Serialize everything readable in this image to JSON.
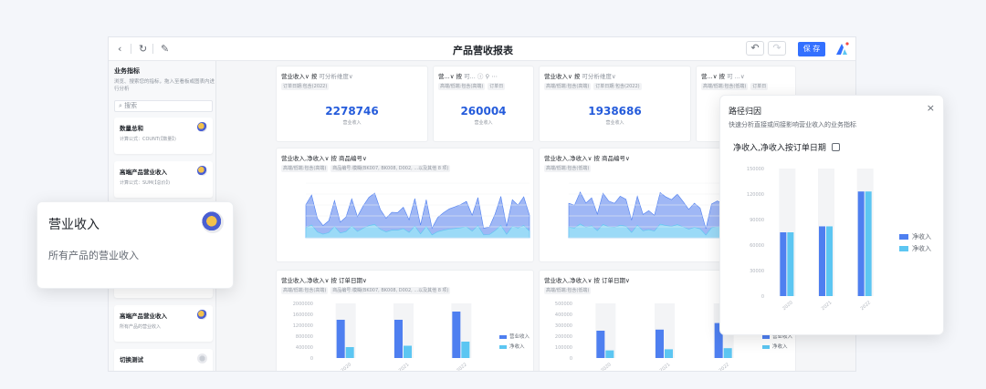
{
  "colors": {
    "accent": "#3370ff",
    "series_dark": "#4e7ff0",
    "series_light": "#5cc6f2",
    "kpi": "#245bdb"
  },
  "topbar": {
    "title": "产品营收报表",
    "save_label": "保 存"
  },
  "sidebar": {
    "title": "业务指标",
    "desc": "浏览、搜索您的指标，拖入至看板或图表内进行分析",
    "search_placeholder": "搜索",
    "cards": [
      {
        "name": "数量总和",
        "sub": "计算公式：COUNT(【数量】)"
      },
      {
        "name": "高端产品营业收入",
        "sub": "计算公式：SUM(【总价】)"
      },
      {
        "name": "高端产品营业收入",
        "sub": "所有产品的营业收入"
      },
      {
        "name": "切换测试",
        "sub": ""
      }
    ]
  },
  "hover_card": {
    "title": "营业收入",
    "desc": "所有产品的营业收入"
  },
  "panels": {
    "kpi1": {
      "head": "营业收入∨ 按",
      "head_hint": "可分析维度∨",
      "filters": [
        "订单日期:包含(2022)"
      ],
      "value": "2278746",
      "label": "营业收入"
    },
    "kpi2": {
      "head": "营...∨ 按",
      "head_hint": "可...",
      "filters": [
        "高端/低端:包含(高端)",
        "订单日"
      ],
      "value": "260004",
      "label": "营业收入"
    },
    "kpi3": {
      "head": "营业收入∨ 按",
      "head_hint": "可分析维度∨",
      "filters": [
        "高端/低端:包含(高端)",
        "订单日期:包含(2022)"
      ],
      "value": "1938686",
      "label": "营业收入"
    },
    "kpi4": {
      "head": "营...∨ 按",
      "head_hint": "可 ...∨",
      "filters": [
        "高端/低端:包含(低端)",
        "订单日"
      ]
    },
    "area1": {
      "head": "营业收入,净收入∨ 按 商品编号∨",
      "filters": [
        "高端/低端:包含(高端)",
        "商品编号:模糊(BK007, BK008, D002, ...以及其他 8 项)"
      ]
    },
    "area2": {
      "head": "营业收入,净收入∨ 按 商品编号∨",
      "filters": [
        "高端/低端:包含(低端)"
      ]
    },
    "bar1": {
      "head": "营业收入,净收入∨ 按 订单日期∨",
      "filters": [
        "高端/低端:包含(高端)",
        "商品编号:模糊(BK007, BK008, D002, ...以及其他 8 项)"
      ],
      "legend": [
        "营业收入",
        "净收入"
      ]
    },
    "bar2": {
      "head": "营业收入,净收入∨ 按 订单日期∨",
      "filters": [
        "高端/低端:包含(低端)"
      ],
      "legend": [
        "营业收入",
        "净收入"
      ]
    }
  },
  "attribution": {
    "title": "路径归因",
    "desc": "快速分析直接或间接影响营业收入的业务指标",
    "subtitle": "净收入,净收入按订单日期",
    "legend": [
      "净收入",
      "净收入"
    ]
  },
  "chart_data": [
    {
      "type": "bar",
      "title": "净收入,净收入按订单日期",
      "categories": [
        "2020",
        "2021",
        "2022"
      ],
      "series": [
        {
          "name": "净收入",
          "values": [
            75000,
            82000,
            123000
          ]
        },
        {
          "name": "净收入",
          "values": [
            75000,
            82000,
            123000
          ]
        }
      ],
      "ylim": [
        0,
        150000
      ],
      "yticks": [
        0,
        30000,
        60000,
        90000,
        120000,
        150000
      ],
      "legend": "right"
    },
    {
      "type": "bar",
      "categories": [
        "2020",
        "2021",
        "2022"
      ],
      "series": [
        {
          "name": "营业收入",
          "values": [
            1400000,
            1400000,
            1700000
          ]
        },
        {
          "name": "净收入",
          "values": [
            400000,
            450000,
            600000
          ]
        }
      ],
      "ylim": [
        0,
        2000000
      ],
      "yticks": [
        0,
        400000,
        800000,
        1200000,
        1600000,
        2000000
      ]
    },
    {
      "type": "bar",
      "categories": [
        "2020",
        "2021",
        "2022"
      ],
      "series": [
        {
          "name": "营业收入",
          "values": [
            250000,
            260000,
            320000
          ]
        },
        {
          "name": "净收入",
          "values": [
            70000,
            80000,
            90000
          ]
        }
      ],
      "ylim": [
        0,
        500000
      ],
      "yticks": [
        0,
        100000,
        200000,
        300000,
        400000,
        500000
      ]
    }
  ]
}
